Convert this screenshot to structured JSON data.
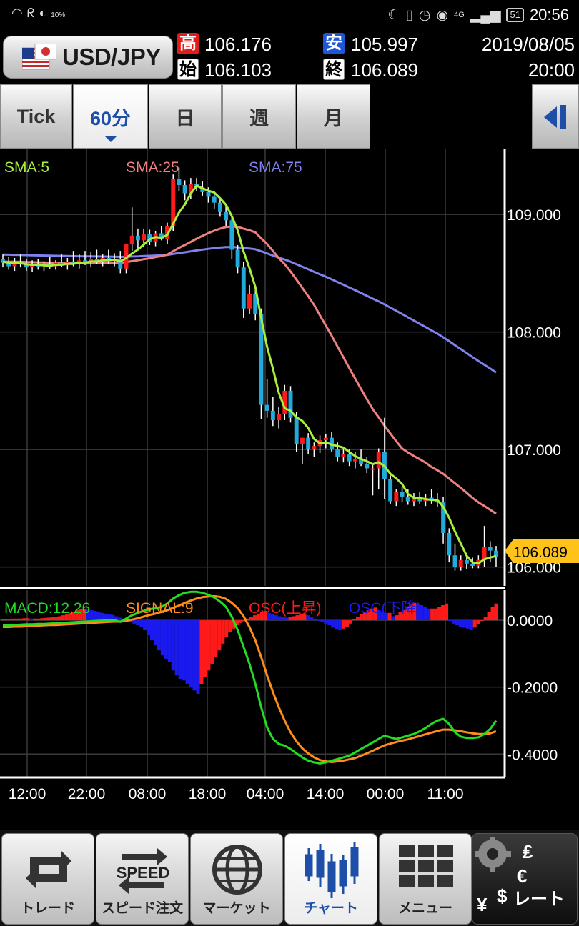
{
  "status_bar": {
    "left_icons": [
      "wifi-icon",
      "nfc-icon",
      "data-saver-icon"
    ],
    "left_small": "10%",
    "right_icons": [
      "moon-icon",
      "vibrate-icon",
      "alarm-icon",
      "eye-icon",
      "signal-icon"
    ],
    "network": "4G",
    "battery": "51",
    "time": "20:56"
  },
  "header": {
    "pair": "USD/JPY",
    "high_label": "高",
    "high": "106.176",
    "open_label": "始",
    "open": "106.103",
    "low_label": "安",
    "low": "105.997",
    "close_label": "終",
    "close": "106.089",
    "date": "2019/08/05",
    "time": "20:00"
  },
  "tabs": [
    {
      "label": "Tick"
    },
    {
      "label": "60分"
    },
    {
      "label": "日"
    },
    {
      "label": "週"
    },
    {
      "label": "月"
    }
  ],
  "active_tab": "60分",
  "colors": {
    "up": "#ff1a1a",
    "down": "#22aadd",
    "sma5": "#a8f03c",
    "sma25": "#f08080",
    "sma75": "#8080ee",
    "macd": "#22dd22",
    "signal": "#ff8c1a",
    "osc_up": "#ff1a1a",
    "osc_down": "#1a1aee",
    "current_price_bg": "#ffc21a"
  },
  "chart_data": [
    {
      "type": "candlestick",
      "pair": "USD/JPY",
      "interval": "60分",
      "legend": [
        "SMA:5",
        "SMA:25",
        "SMA:75"
      ],
      "ylim": [
        105.84,
        109.56
      ],
      "y_ticks": [
        "109.000",
        "108.000",
        "107.000",
        "106.000"
      ],
      "x_ticks": [
        "12:00",
        "22:00",
        "08:00",
        "18:00",
        "04:00",
        "14:00",
        "00:00",
        "11:00"
      ],
      "current_price": "106.089",
      "sma75_end": 107.63,
      "sma25_end": 106.34,
      "candles": [
        [
          108.62,
          108.66,
          108.55,
          108.59
        ],
        [
          108.59,
          108.64,
          108.53,
          108.56
        ],
        [
          108.56,
          108.63,
          108.52,
          108.6
        ],
        [
          108.6,
          108.66,
          108.55,
          108.58
        ],
        [
          108.58,
          108.62,
          108.52,
          108.55
        ],
        [
          108.55,
          108.61,
          108.51,
          108.57
        ],
        [
          108.57,
          108.62,
          108.53,
          108.56
        ],
        [
          108.56,
          108.6,
          108.52,
          108.58
        ],
        [
          108.58,
          108.64,
          108.54,
          108.56
        ],
        [
          108.56,
          108.61,
          108.53,
          108.59
        ],
        [
          108.59,
          108.66,
          108.55,
          108.57
        ],
        [
          108.57,
          108.63,
          108.53,
          108.6
        ],
        [
          108.6,
          108.69,
          108.56,
          108.58
        ],
        [
          108.58,
          108.66,
          108.54,
          108.61
        ],
        [
          108.61,
          108.69,
          108.57,
          108.59
        ],
        [
          108.59,
          108.68,
          108.55,
          108.62
        ],
        [
          108.62,
          108.7,
          108.58,
          108.6
        ],
        [
          108.6,
          108.66,
          108.56,
          108.63
        ],
        [
          108.63,
          108.7,
          108.58,
          108.61
        ],
        [
          108.61,
          108.67,
          108.56,
          108.62
        ],
        [
          108.62,
          108.69,
          108.5,
          108.54
        ],
        [
          108.54,
          108.66,
          108.5,
          108.75
        ],
        [
          108.75,
          109.06,
          108.69,
          108.82
        ],
        [
          108.82,
          108.88,
          108.7,
          108.78
        ],
        [
          108.78,
          108.88,
          108.72,
          108.83
        ],
        [
          108.83,
          108.87,
          108.74,
          108.77
        ],
        [
          108.77,
          108.86,
          108.73,
          108.84
        ],
        [
          108.84,
          108.9,
          108.78,
          108.79
        ],
        [
          108.79,
          108.93,
          108.75,
          108.9
        ],
        [
          108.9,
          109.34,
          108.86,
          109.3
        ],
        [
          109.3,
          109.4,
          109.2,
          109.25
        ],
        [
          109.25,
          109.29,
          109.12,
          109.18
        ],
        [
          109.18,
          109.31,
          109.13,
          109.26
        ],
        [
          109.26,
          109.31,
          109.2,
          109.23
        ],
        [
          109.23,
          109.28,
          109.16,
          109.19
        ],
        [
          109.19,
          109.23,
          109.1,
          109.15
        ],
        [
          109.15,
          109.2,
          109.05,
          109.1
        ],
        [
          109.1,
          109.14,
          108.98,
          109.02
        ],
        [
          109.02,
          109.08,
          108.9,
          108.95
        ],
        [
          108.95,
          108.99,
          108.62,
          108.7
        ],
        [
          108.7,
          108.74,
          108.5,
          108.55
        ],
        [
          108.55,
          108.6,
          108.12,
          108.2
        ],
        [
          108.2,
          108.4,
          108.15,
          108.32
        ],
        [
          108.32,
          108.36,
          108.1,
          108.15
        ],
        [
          108.15,
          108.2,
          107.26,
          107.38
        ],
        [
          107.38,
          107.6,
          107.27,
          107.33
        ],
        [
          107.33,
          107.45,
          107.2,
          107.25
        ],
        [
          107.25,
          107.36,
          107.18,
          107.3
        ],
        [
          107.3,
          107.55,
          107.25,
          107.5
        ],
        [
          107.5,
          107.54,
          107.23,
          107.27
        ],
        [
          107.27,
          107.32,
          106.98,
          107.05
        ],
        [
          107.05,
          107.1,
          106.88,
          107.1
        ],
        [
          107.1,
          107.14,
          106.96,
          107.0
        ],
        [
          107.0,
          107.06,
          106.94,
          107.03
        ],
        [
          107.03,
          107.12,
          106.97,
          107.08
        ],
        [
          107.08,
          107.13,
          107.01,
          107.1
        ],
        [
          107.1,
          107.15,
          106.98,
          107.0
        ],
        [
          107.0,
          107.06,
          106.9,
          106.94
        ],
        [
          106.94,
          107.02,
          106.89,
          106.96
        ],
        [
          106.96,
          107.0,
          106.86,
          106.9
        ],
        [
          106.9,
          106.98,
          106.84,
          106.92
        ],
        [
          106.92,
          107.0,
          106.86,
          106.88
        ],
        [
          106.88,
          106.94,
          106.8,
          106.84
        ],
        [
          106.84,
          106.88,
          106.61,
          106.84
        ],
        [
          106.84,
          107.01,
          106.66,
          106.98
        ],
        [
          106.98,
          107.27,
          106.58,
          106.75
        ],
        [
          106.75,
          106.78,
          106.54,
          106.56
        ],
        [
          106.56,
          106.66,
          106.52,
          106.64
        ],
        [
          106.64,
          106.68,
          106.55,
          106.6
        ],
        [
          106.6,
          106.66,
          106.53,
          106.56
        ],
        [
          106.56,
          106.63,
          106.52,
          106.58
        ],
        [
          106.58,
          106.64,
          106.54,
          106.56
        ],
        [
          106.56,
          106.62,
          106.52,
          106.59
        ],
        [
          106.59,
          106.66,
          106.54,
          106.57
        ],
        [
          106.57,
          106.63,
          106.51,
          106.55
        ],
        [
          106.55,
          106.6,
          106.2,
          106.29
        ],
        [
          106.29,
          106.33,
          106.04,
          106.1
        ],
        [
          106.1,
          106.2,
          105.97,
          106.0
        ],
        [
          106.0,
          106.1,
          105.97,
          106.06
        ],
        [
          106.06,
          106.12,
          105.98,
          106.03
        ],
        [
          106.03,
          106.08,
          105.99,
          106.01
        ],
        [
          106.01,
          106.1,
          105.99,
          106.06
        ],
        [
          106.06,
          106.35,
          106.0,
          106.17
        ],
        [
          106.17,
          106.22,
          106.04,
          106.14
        ],
        [
          106.14,
          106.18,
          106.0,
          106.089
        ]
      ]
    },
    {
      "type": "macd",
      "legend": [
        "MACD:12,26",
        "SIGNAL:9",
        "OSC(上昇)",
        "OSC(下降)"
      ],
      "ylim": [
        -0.47,
        0.09
      ],
      "y_ticks": [
        "0.0000",
        "-0.2000",
        "-0.4000"
      ],
      "macd": [
        -0.015,
        -0.015,
        -0.014,
        -0.013,
        -0.012,
        -0.012,
        -0.011,
        -0.011,
        -0.01,
        -0.009,
        -0.008,
        -0.007,
        -0.006,
        -0.005,
        -0.004,
        -0.003,
        -0.002,
        -0.001,
        0.0,
        0.0,
        -0.005,
        0.005,
        0.015,
        0.022,
        0.028,
        0.033,
        0.036,
        0.04,
        0.05,
        0.065,
        0.075,
        0.082,
        0.085,
        0.085,
        0.082,
        0.076,
        0.068,
        0.056,
        0.04,
        0.01,
        -0.03,
        -0.08,
        -0.13,
        -0.19,
        -0.26,
        -0.32,
        -0.355,
        -0.37,
        -0.375,
        -0.385,
        -0.398,
        -0.41,
        -0.42,
        -0.425,
        -0.428,
        -0.425,
        -0.42,
        -0.415,
        -0.41,
        -0.405,
        -0.395,
        -0.385,
        -0.375,
        -0.365,
        -0.355,
        -0.345,
        -0.35,
        -0.355,
        -0.35,
        -0.345,
        -0.34,
        -0.332,
        -0.322,
        -0.31,
        -0.3,
        -0.295,
        -0.31,
        -0.335,
        -0.348,
        -0.352,
        -0.352,
        -0.35,
        -0.34,
        -0.325,
        -0.3
      ],
      "signal": [
        -0.02,
        -0.02,
        -0.019,
        -0.019,
        -0.018,
        -0.017,
        -0.016,
        -0.015,
        -0.014,
        -0.014,
        -0.013,
        -0.012,
        -0.011,
        -0.01,
        -0.009,
        -0.008,
        -0.007,
        -0.006,
        -0.005,
        -0.004,
        -0.004,
        -0.002,
        0.002,
        0.006,
        0.011,
        0.016,
        0.02,
        0.025,
        0.03,
        0.037,
        0.044,
        0.052,
        0.059,
        0.065,
        0.069,
        0.071,
        0.072,
        0.07,
        0.064,
        0.052,
        0.036,
        0.012,
        -0.02,
        -0.06,
        -0.11,
        -0.165,
        -0.215,
        -0.26,
        -0.3,
        -0.335,
        -0.362,
        -0.383,
        -0.398,
        -0.41,
        -0.418,
        -0.422,
        -0.424,
        -0.422,
        -0.42,
        -0.416,
        -0.412,
        -0.405,
        -0.398,
        -0.39,
        -0.382,
        -0.374,
        -0.369,
        -0.364,
        -0.36,
        -0.356,
        -0.351,
        -0.346,
        -0.341,
        -0.336,
        -0.331,
        -0.327,
        -0.327,
        -0.329,
        -0.332,
        -0.335,
        -0.338,
        -0.34,
        -0.34,
        -0.338,
        -0.332
      ],
      "osc": [
        0.003,
        0.004,
        0.004,
        0.005,
        0.005,
        0.005,
        0.006,
        0.006,
        0.005,
        0.005,
        0.005,
        0.006,
        0.007,
        0.008,
        0.009,
        0.01,
        0.012,
        0.015,
        0.018,
        0.022,
        0.025,
        0.03,
        0.033,
        0.034,
        0.032,
        0.03,
        0.028,
        0.026,
        0.022,
        0.02,
        0.018,
        0.016,
        0.012,
        0.008,
        0.004,
        0.0,
        -0.005,
        -0.01,
        -0.015,
        -0.02,
        -0.03,
        -0.045,
        -0.06,
        -0.075,
        -0.09,
        -0.105,
        -0.115,
        -0.125,
        -0.15,
        -0.165,
        -0.175,
        -0.18,
        -0.19,
        -0.2,
        -0.21,
        -0.22,
        -0.19,
        -0.17,
        -0.15,
        -0.13,
        -0.11,
        -0.09,
        -0.07,
        -0.05,
        -0.035,
        -0.025,
        -0.015,
        -0.008,
        -0.003,
        0.005,
        0.01,
        0.015,
        0.02,
        0.025,
        0.028,
        0.022,
        0.018,
        0.015,
        0.012,
        0.01,
        0.008,
        0.01,
        0.012,
        0.015,
        0.018,
        0.02,
        0.015,
        0.01,
        0.005,
        0.0,
        -0.005,
        -0.01,
        -0.015,
        -0.022,
        -0.028,
        -0.03,
        -0.025,
        -0.02,
        -0.01,
        0.003,
        0.01,
        0.018,
        0.025,
        0.03,
        0.035,
        0.038,
        0.03,
        0.024,
        0.022,
        0.022,
        0.012,
        0.015,
        0.025,
        0.03,
        0.04,
        0.05,
        0.052,
        0.05,
        0.045,
        0.04,
        0.035,
        0.035,
        0.035,
        0.04,
        0.045,
        0.05,
        0.0,
        -0.01,
        -0.015,
        -0.02,
        -0.022,
        -0.025,
        -0.03,
        -0.022,
        -0.012,
        0.0,
        0.01,
        0.025,
        0.04,
        0.05
      ]
    }
  ],
  "bottom_nav": [
    {
      "label": "トレード",
      "icon": "trade-arrows-icon"
    },
    {
      "label": "スピード注文",
      "icon": "speed-order-icon",
      "icon_text": "SPEED"
    },
    {
      "label": "マーケット",
      "icon": "globe-icon"
    },
    {
      "label": "チャート",
      "icon": "candlestick-chart-icon"
    },
    {
      "label": "メニュー",
      "icon": "menu-grid-icon"
    },
    {
      "label": "レート",
      "icon": "currency-gear-icon"
    }
  ]
}
